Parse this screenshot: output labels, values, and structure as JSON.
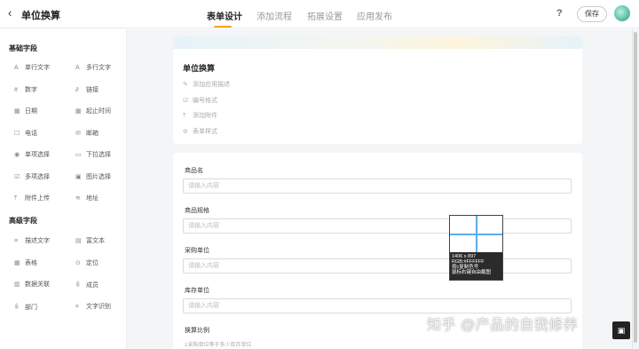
{
  "header": {
    "back_icon": "‹",
    "title": "单位换算",
    "tabs": [
      {
        "label": "表单设计",
        "active": true
      },
      {
        "label": "添加流程",
        "active": false
      },
      {
        "label": "拓展设置",
        "active": false
      },
      {
        "label": "应用发布",
        "active": false
      }
    ],
    "help_icon": "?",
    "save_label": "保存"
  },
  "sidebar": {
    "basic_title": "基础字段",
    "basic_fields": [
      {
        "icon": "A",
        "label": "单行文字"
      },
      {
        "icon": "A",
        "label": "多行文字"
      },
      {
        "icon": "#",
        "label": "数字"
      },
      {
        "icon": "∂",
        "label": "链接"
      },
      {
        "icon": "▦",
        "label": "日期"
      },
      {
        "icon": "▦",
        "label": "起止时间"
      },
      {
        "icon": "☐",
        "label": "电话"
      },
      {
        "icon": "✉",
        "label": "邮箱"
      },
      {
        "icon": "◉",
        "label": "单项选择"
      },
      {
        "icon": "▭",
        "label": "下拉选择"
      },
      {
        "icon": "☑",
        "label": "多项选择"
      },
      {
        "icon": "▣",
        "label": "图片选择"
      },
      {
        "icon": "⤒",
        "label": "附件上传"
      },
      {
        "icon": "≋",
        "label": "地址"
      }
    ],
    "advanced_title": "高级字段",
    "advanced_fields": [
      {
        "icon": "≡",
        "label": "描述文字"
      },
      {
        "icon": "▤",
        "label": "富文本"
      },
      {
        "icon": "▦",
        "label": "表格"
      },
      {
        "icon": "⊙",
        "label": "定位"
      },
      {
        "icon": "▥",
        "label": "数据关联"
      },
      {
        "icon": "ꆜ",
        "label": "成员"
      },
      {
        "icon": "ꆜ",
        "label": "部门"
      },
      {
        "icon": "⌗",
        "label": "文字识别"
      }
    ]
  },
  "form": {
    "title": "单位换算",
    "options": [
      {
        "icon": "✎",
        "label": "添加应用描述"
      },
      {
        "icon": "☑",
        "label": "编号格式"
      },
      {
        "icon": "⤒",
        "label": "添加附件"
      },
      {
        "icon": "⊘",
        "label": "表单样式"
      }
    ],
    "fields": [
      {
        "label": "商品名",
        "placeholder": "请输入内容"
      },
      {
        "label": "商品规格",
        "placeholder": "请输入内容"
      },
      {
        "label": "采购单位",
        "placeholder": "请输入内容"
      },
      {
        "label": "库存单位",
        "placeholder": "请输入内容"
      }
    ],
    "ratio_label": "换算比例",
    "ratio_hint": "1采购单位等于多少库存单位"
  },
  "color_picker": {
    "lines": [
      "1406 x 897",
      "RGB:#FFFFFF",
      "按c复制色号",
      "鼠标右键自由截图"
    ]
  },
  "watermark": "知乎 @产品的自我修养",
  "colors": {
    "accent": "#f5a623",
    "crosshair": "#5aaee8"
  }
}
